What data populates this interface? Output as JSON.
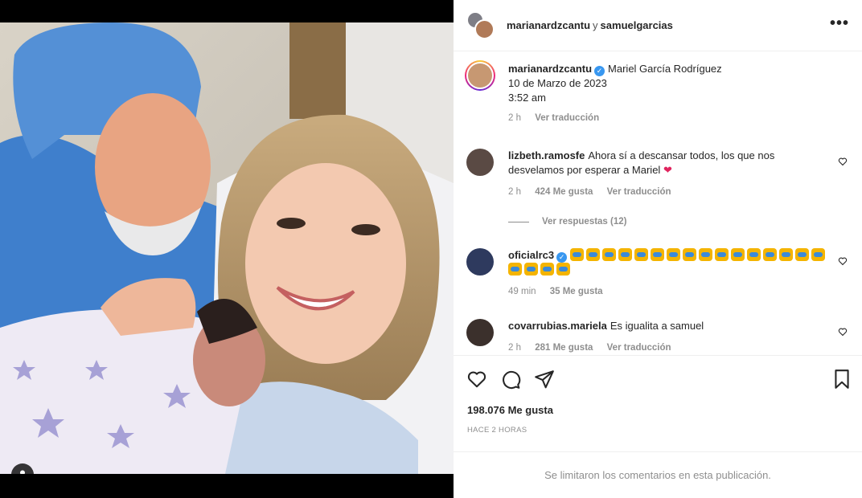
{
  "post": {
    "header": {
      "user1": "marianardzcantu",
      "separator": "y",
      "user2": "samuelgarcias",
      "more_label": "•••"
    },
    "caption": {
      "username": "marianardzcantu",
      "line1": "Mariel García Rodríguez",
      "line2": "10 de Marzo de 2023",
      "line3": "3:52 am",
      "time": "2 h",
      "translate": "Ver traducción"
    },
    "comments": [
      {
        "username": "lizbeth.ramosfe",
        "text": "Ahora sí a descansar todos, los que nos desvelamos por esperar a Mariel",
        "emoji": "❤",
        "time": "2 h",
        "likes": "424 Me gusta",
        "translate": "Ver traducción",
        "replies": "Ver respuestas (12)"
      },
      {
        "username": "oficialrc3",
        "emoji_count": 20,
        "time": "49 min",
        "likes": "35 Me gusta"
      },
      {
        "username": "covarrubias.mariela",
        "text": "Es igualita a samuel",
        "time": "2 h",
        "likes": "281 Me gusta",
        "translate": "Ver traducción"
      }
    ],
    "likes": "198.076 Me gusta",
    "posted_ago": "HACE 2 HORAS",
    "comments_limited": "Se limitaron los comentarios en esta publicación."
  },
  "icons": {
    "heart": "heart-icon",
    "comment": "comment-icon",
    "share": "share-icon",
    "save": "bookmark-icon",
    "tagged_users": "user-tag-icon",
    "verified": "verified-badge-icon"
  },
  "colors": {
    "verified": "#3897f0",
    "heart_red": "#e0245e",
    "muted_text": "#8e8e8e",
    "divider": "#efefef"
  }
}
